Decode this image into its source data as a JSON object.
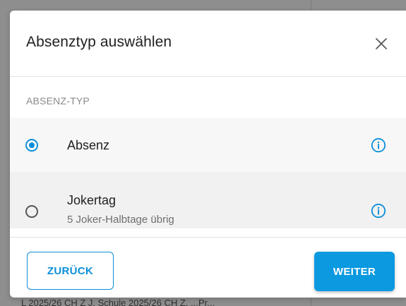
{
  "dialog": {
    "title": "Absenztyp auswählen",
    "close_icon": "close-icon",
    "section_label": "ABSENZ-TYP",
    "options": [
      {
        "label": "Absenz",
        "subtitle": "",
        "selected": true,
        "info_icon": "info-icon"
      },
      {
        "label": "Jokertag",
        "subtitle": "5 Joker-Halbtage übrig",
        "selected": false,
        "info_icon": "info-icon"
      }
    ],
    "back_label": "ZURÜCK",
    "next_label": "WEITER"
  },
  "background": {
    "partial_text": "L 2025/26 CH Z J, Schule 2025/26 CH Z, ...Pr..."
  },
  "colors": {
    "accent": "#0b8fd9",
    "button_primary": "#0b99e0",
    "overlay": "#8e8e8e",
    "text_primary": "#212121",
    "text_secondary": "#6e6e6e"
  }
}
